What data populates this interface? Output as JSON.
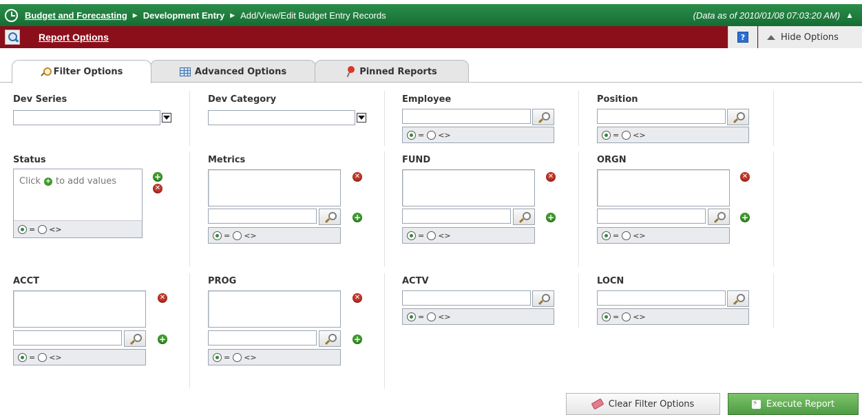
{
  "header": {
    "crumb_home": "Budget and Forecasting",
    "crumb_section": "Development Entry",
    "crumb_page": "Add/View/Edit Budget Entry Records",
    "as_of": "(Data as of 2010/01/08 07:03:20 AM)"
  },
  "options_bar": {
    "title": "Report Options",
    "help_label": "?",
    "hide_label": "Hide Options"
  },
  "tabs": [
    {
      "label": "Filter Options",
      "icon": "magnifier-icon",
      "active": true
    },
    {
      "label": "Advanced Options",
      "icon": "table-icon",
      "active": false
    },
    {
      "label": "Pinned Reports",
      "icon": "pin-icon",
      "active": false
    }
  ],
  "filters": {
    "dev_series": {
      "label": "Dev Series",
      "value": ""
    },
    "dev_category": {
      "label": "Dev Category",
      "value": ""
    },
    "employee": {
      "label": "Employee",
      "value": ""
    },
    "position": {
      "label": "Position",
      "value": ""
    },
    "status": {
      "label": "Status",
      "hint_prefix": "Click",
      "hint_suffix": "to add values"
    },
    "metrics": {
      "label": "Metrics",
      "value": ""
    },
    "fund": {
      "label": "FUND",
      "value": ""
    },
    "orgn": {
      "label": "ORGN",
      "value": ""
    },
    "acct": {
      "label": "ACCT",
      "value": ""
    },
    "prog": {
      "label": "PROG",
      "value": ""
    },
    "actv": {
      "label": "ACTV",
      "value": ""
    },
    "locn": {
      "label": "LOCN",
      "value": ""
    }
  },
  "operators": {
    "equals": "=",
    "not_equals": "<>"
  },
  "buttons": {
    "clear": "Clear Filter Options",
    "execute": "Execute Report"
  },
  "colors": {
    "header_green": "#156d33",
    "options_red": "#8a0f1b",
    "execute_green": "#4f9c44"
  }
}
